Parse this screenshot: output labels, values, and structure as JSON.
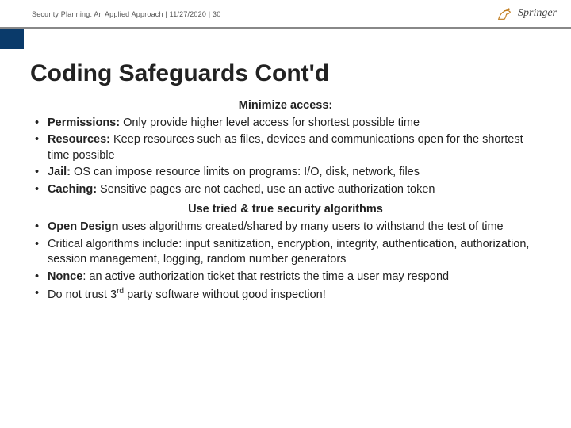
{
  "header": {
    "doc_title": "Security Planning: An Applied Approach",
    "date": "11/27/2020",
    "page": "30",
    "publisher": "Springer"
  },
  "title": "Coding Safeguards Cont'd",
  "section1": {
    "heading": "Minimize access:",
    "items": [
      {
        "term": "Permissions:",
        "text": "  Only provide higher level access for shortest possible time"
      },
      {
        "term": "Resources:",
        "text": "  Keep resources such as files, devices and communications open for the shortest time possible"
      },
      {
        "term": "Jail:",
        "text": "  OS can impose resource limits on programs: I/O, disk, network, files"
      },
      {
        "term": "Caching:",
        "text": "  Sensitive pages are not cached, use an active authorization token"
      }
    ]
  },
  "section2": {
    "heading": "Use tried & true security algorithms",
    "items": [
      {
        "term": "Open Design",
        "text": " uses algorithms created/shared by many users to withstand the test of time"
      },
      {
        "text": "Critical algorithms include: input sanitization, encryption, integrity, authentication, authorization, session management, logging, random number generators"
      },
      {
        "term": "Nonce",
        "text": ": an active authorization ticket that restricts the time a user  may respond"
      },
      {
        "pre": "Do not trust ",
        "num": "3",
        "sup": "rd",
        "post": " party software without good inspection!"
      }
    ]
  }
}
